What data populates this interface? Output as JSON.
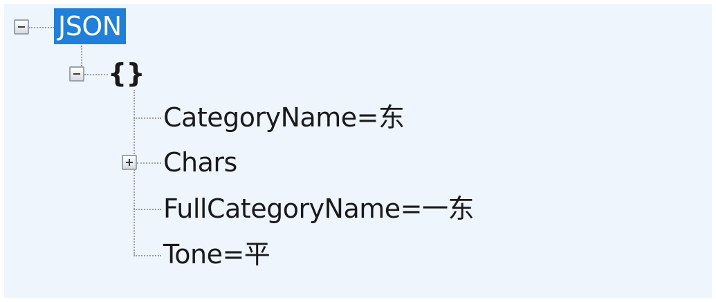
{
  "tree": {
    "root": {
      "label": "JSON",
      "expanded": true,
      "selected": true
    },
    "object_node": {
      "label": "{}",
      "expanded": true
    },
    "children": [
      {
        "label": "CategoryName=东",
        "has_children": false
      },
      {
        "label": "Chars",
        "has_children": true,
        "expanded": false
      },
      {
        "label": "FullCategoryName=一东",
        "has_children": false
      },
      {
        "label": "Tone=平",
        "has_children": false
      }
    ]
  },
  "icons": {
    "collapse": "collapse-minus-icon",
    "expand": "expand-plus-icon"
  },
  "colors": {
    "panel_background": "#eef5fc",
    "selection_background": "#1f7fd9",
    "selection_text": "#ffffff",
    "text": "#1a1a1a",
    "connector_lines": "#a0a0a0"
  }
}
